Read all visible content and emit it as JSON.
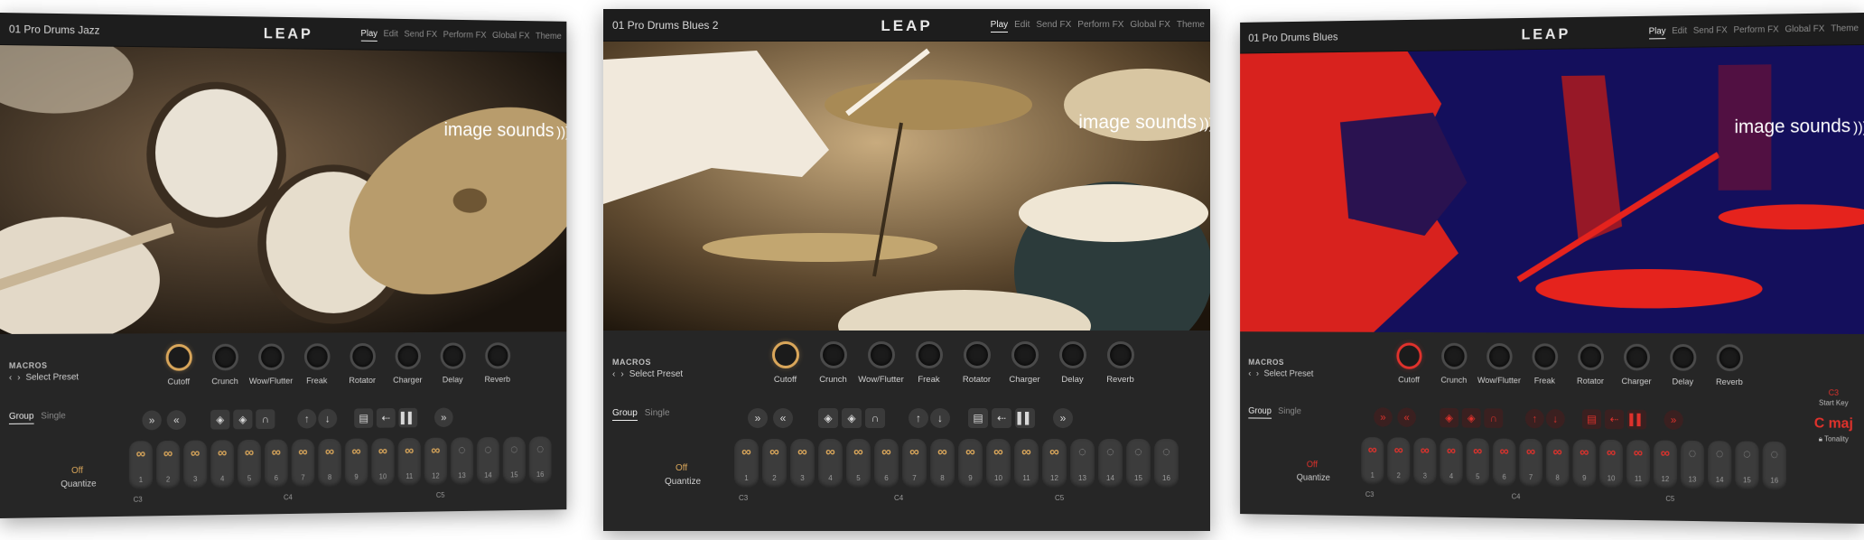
{
  "logo": "LEAP",
  "tabs": [
    "Play",
    "Edit",
    "Send FX",
    "Perform FX",
    "Global FX",
    "Theme"
  ],
  "brand": "image sounds",
  "macros_label": "MACROS",
  "select_preset": "Select Preset",
  "knobs": [
    "Cutoff",
    "Crunch",
    "Wow/Flutter",
    "Freak",
    "Rotator",
    "Charger",
    "Delay",
    "Reverb"
  ],
  "modes": [
    "Group",
    "Single"
  ],
  "quantize": {
    "value": "Off",
    "label": "Quantize"
  },
  "pads": [
    "1",
    "2",
    "3",
    "4",
    "5",
    "6",
    "7",
    "8",
    "9",
    "10",
    "11",
    "12",
    "13",
    "14",
    "15",
    "16"
  ],
  "notes": [
    "C3",
    "C4",
    "C5"
  ],
  "panels": [
    {
      "title": "01 Pro Drums Jazz",
      "accent": "#d9a65a",
      "hero": "sepia-drums"
    },
    {
      "title": "01 Pro Drums Blues 2",
      "accent": "#d9a65a",
      "hero": "golden-drummer"
    },
    {
      "title": "01 Pro Drums Blues",
      "accent": "#e0322c",
      "hero": "red-navy-drummer",
      "start_key": {
        "value": "C3",
        "label": "Start Key"
      },
      "tonality": {
        "value": "C maj",
        "label": "Tonality"
      }
    }
  ]
}
